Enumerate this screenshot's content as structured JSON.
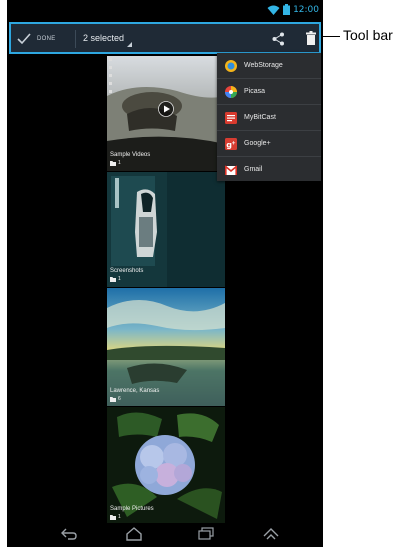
{
  "status_bar": {
    "time": "12:00",
    "wifi_icon": "wifi-icon",
    "battery_icon": "battery-icon"
  },
  "toolbar": {
    "done_label": "DONE",
    "selected_label": "2 selected",
    "share_icon": "share-icon",
    "delete_icon": "trash-icon"
  },
  "callout": {
    "label": "Tool bar"
  },
  "share_menu": {
    "items": [
      {
        "label": "WebStorage",
        "icon": "webstorage-icon",
        "color": "#2f8fe0"
      },
      {
        "label": "Picasa",
        "icon": "picasa-icon",
        "color": "#e8453c"
      },
      {
        "label": "MyBitCast",
        "icon": "mybitcast-icon",
        "color": "#d83a2e"
      },
      {
        "label": "Google+",
        "icon": "google-plus-icon",
        "color": "#d73d32"
      },
      {
        "label": "Gmail",
        "icon": "gmail-icon",
        "color": "#d93025"
      }
    ]
  },
  "albums": [
    {
      "title": "Sample Videos",
      "count": "1",
      "selected": false
    },
    {
      "title": "Screenshots",
      "count": "1",
      "selected": true
    },
    {
      "title": "Lawrence, Kansas",
      "count": "6",
      "selected": true
    },
    {
      "title": "Sample Pictures",
      "count": "1",
      "selected": false
    }
  ],
  "nav_bar": {
    "back_icon": "back-icon",
    "home_icon": "home-icon",
    "recents_icon": "recent-apps-icon",
    "menu_icon": "screenshot-icon"
  },
  "colors": {
    "accent": "#2ea7e0",
    "toolbar_bg": "#1f2a36",
    "menu_bg": "#2b2d30"
  }
}
